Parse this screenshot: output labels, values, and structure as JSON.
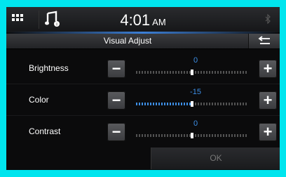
{
  "status": {
    "time": "4:01",
    "ampm": "AM"
  },
  "titlebar": {
    "title": "Visual Adjust"
  },
  "settings": [
    {
      "label": "Brightness",
      "value": "0",
      "level": 0.5
    },
    {
      "label": "Color",
      "value": "-15",
      "level": 0.5
    },
    {
      "label": "Contrast",
      "value": "0",
      "level": 0.5
    }
  ],
  "footer": {
    "ok_label": "OK"
  },
  "colors": {
    "accent": "#3d8fe6",
    "border": "#00e5ee"
  }
}
